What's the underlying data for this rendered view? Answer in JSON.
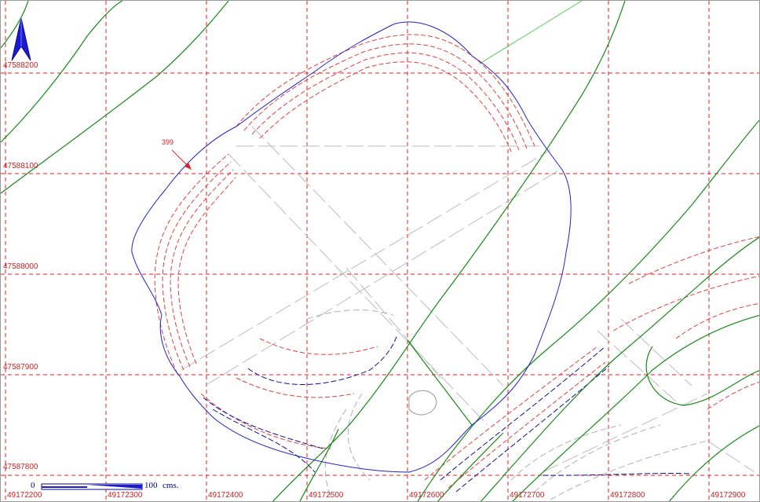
{
  "map": {
    "grid_x_labels": [
      "49172200",
      "49172300",
      "49172400",
      "49172500",
      "49172600",
      "49172700",
      "49172800",
      "49172900"
    ],
    "grid_y_labels": [
      "47588200",
      "47588100",
      "47588000",
      "47587900",
      "47587800"
    ],
    "parcel_label": "399",
    "scale": {
      "start": "0",
      "end": "100",
      "unit": "cms."
    },
    "north_arrow": "north-arrow-icon",
    "colors": {
      "grid": "#dd2222",
      "boundary": "#2222cc",
      "contour_green": "#1a8a1a",
      "contour_light_green": "#55cc55",
      "dashed_red": "#e04040",
      "dashed_blue": "#101090",
      "dashed_gray": "#b8b8b8"
    }
  }
}
